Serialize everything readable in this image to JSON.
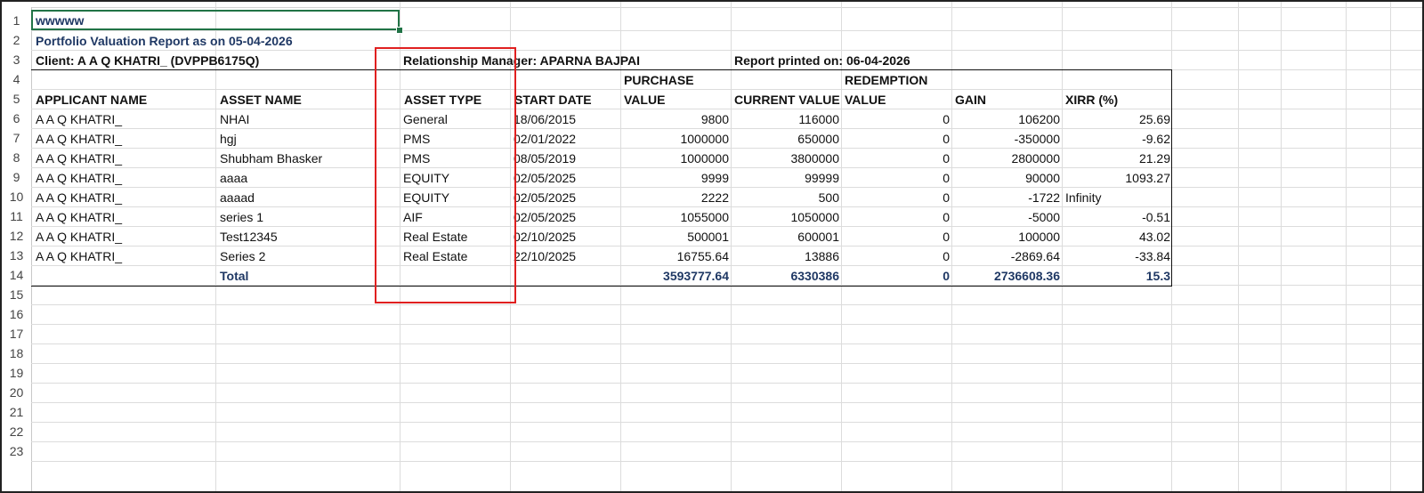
{
  "sheet": {
    "row_numbers": [
      "1",
      "2",
      "3",
      "4",
      "5",
      "6",
      "7",
      "8",
      "9",
      "10",
      "11",
      "12",
      "13",
      "14",
      "15",
      "16",
      "17",
      "18",
      "19",
      "20",
      "21",
      "22",
      "23"
    ],
    "a1_value": "wwwww",
    "report_title": "Portfolio Valuation Report as on 05-04-2026",
    "client": "Client: A A Q KHATRI_ (DVPPB6175Q)",
    "relationship_manager": "Relationship Manager: APARNA BAJPAI",
    "report_printed": "Report printed on: 06-04-2026",
    "headers": {
      "applicant_name": "APPLICANT NAME",
      "asset_name": "ASSET NAME",
      "asset_type": "ASSET TYPE",
      "start_date": "START DATE",
      "purchase_value_1": "PURCHASE",
      "purchase_value_2": "VALUE",
      "current_value": "CURRENT VALUE",
      "redemption_value_1": "REDEMPTION",
      "redemption_value_2": "VALUE",
      "gain": "GAIN",
      "xirr": "XIRR (%)"
    },
    "rows": [
      {
        "applicant": "A A Q KHATRI_",
        "asset": "NHAI",
        "type": "General",
        "start": "18/06/2015",
        "purchase": "9800",
        "current": "116000",
        "redemption": "0",
        "gain": "106200",
        "xirr": "25.69",
        "xirr_text": false
      },
      {
        "applicant": "A A Q KHATRI_",
        "asset": "hgj",
        "type": "PMS",
        "start": "02/01/2022",
        "purchase": "1000000",
        "current": "650000",
        "redemption": "0",
        "gain": "-350000",
        "xirr": "-9.62",
        "xirr_text": false
      },
      {
        "applicant": "A A Q KHATRI_",
        "asset": "Shubham Bhasker",
        "type": "PMS",
        "start": "08/05/2019",
        "purchase": "1000000",
        "current": "3800000",
        "redemption": "0",
        "gain": "2800000",
        "xirr": "21.29",
        "xirr_text": false
      },
      {
        "applicant": "A A Q KHATRI_",
        "asset": "aaaa",
        "type": "EQUITY",
        "start": "02/05/2025",
        "purchase": "9999",
        "current": "99999",
        "redemption": "0",
        "gain": "90000",
        "xirr": "1093.27",
        "xirr_text": false
      },
      {
        "applicant": "A A Q KHATRI_",
        "asset": "aaaad",
        "type": "EQUITY",
        "start": "02/05/2025",
        "purchase": "2222",
        "current": "500",
        "redemption": "0",
        "gain": "-1722",
        "xirr": "Infinity",
        "xirr_text": true
      },
      {
        "applicant": "A A Q KHATRI_",
        "asset": "series 1",
        "type": "AIF",
        "start": "02/05/2025",
        "purchase": "1055000",
        "current": "1050000",
        "redemption": "0",
        "gain": "-5000",
        "xirr": "-0.51",
        "xirr_text": false
      },
      {
        "applicant": "A A Q KHATRI_",
        "asset": "Test12345",
        "type": "Real Estate",
        "start": "02/10/2025",
        "purchase": "500001",
        "current": "600001",
        "redemption": "0",
        "gain": "100000",
        "xirr": "43.02",
        "xirr_text": false
      },
      {
        "applicant": "A A Q KHATRI_",
        "asset": "Series 2",
        "type": "Real Estate",
        "start": "22/10/2025",
        "purchase": "16755.64",
        "current": "13886",
        "redemption": "0",
        "gain": "-2869.64",
        "xirr": "-33.84",
        "xirr_text": false
      }
    ],
    "total": {
      "label": "Total",
      "purchase": "3593777.64",
      "current": "6330386",
      "redemption": "0",
      "gain": "2736608.36",
      "xirr": "15.3"
    }
  },
  "colors": {
    "selection": "#217346",
    "highlight_box": "#e02020",
    "title_text": "#1f3864"
  }
}
